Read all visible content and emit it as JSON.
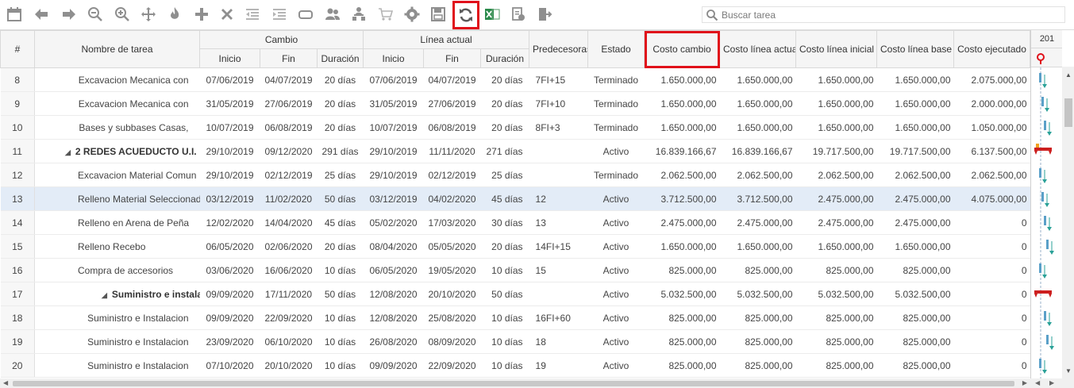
{
  "toolbar": {
    "search_placeholder": "Buscar tarea"
  },
  "columns": {
    "num": "#",
    "nombre": "Nombre de tarea",
    "cambio_group": "Cambio",
    "linea_group": "Línea actual",
    "inicio": "Inicio",
    "fin": "Fin",
    "duracion": "Duración",
    "predecesoras": "Predecesoras",
    "estado": "Estado",
    "costo_cambio": "Costo cambio",
    "costo_linea_actual": "Costo línea actual",
    "costo_linea_inicial": "Costo línea inicial",
    "costo_linea_base": "Costo línea base",
    "costo_ejecutado": "Costo ejecutado",
    "gantt_year": "201"
  },
  "rows": [
    {
      "n": "8",
      "name": "Excavacion Mecanica con",
      "ci": "07/06/2019",
      "cf": "04/07/2019",
      "cd": "20 días",
      "li": "07/06/2019",
      "lf": "04/07/2019",
      "ld": "20 días",
      "pred": "7FI+15",
      "estado": "Terminado",
      "cc": "1.650.000,00",
      "cla": "1.650.000,00",
      "cli": "1.650.000,00",
      "clb": "1.650.000,00",
      "ce": "2.075.000,00"
    },
    {
      "n": "9",
      "name": "Excavacion Mecanica con",
      "ci": "31/05/2019",
      "cf": "27/06/2019",
      "cd": "20 días",
      "li": "31/05/2019",
      "lf": "27/06/2019",
      "ld": "20 días",
      "pred": "7FI+10",
      "estado": "Terminado",
      "cc": "1.650.000,00",
      "cla": "1.650.000,00",
      "cli": "1.650.000,00",
      "clb": "1.650.000,00",
      "ce": "2.000.000,00"
    },
    {
      "n": "10",
      "name": "Bases y subbases Casas,",
      "ci": "10/07/2019",
      "cf": "06/08/2019",
      "cd": "20 días",
      "li": "10/07/2019",
      "lf": "06/08/2019",
      "ld": "20 días",
      "pred": "8FI+3",
      "estado": "Terminado",
      "cc": "1.650.000,00",
      "cla": "1.650.000,00",
      "cli": "1.650.000,00",
      "clb": "1.650.000,00",
      "ce": "1.050.000,00"
    },
    {
      "n": "11",
      "name": "2 REDES ACUEDUCTO U.I.",
      "ci": "29/10/2019",
      "cf": "09/12/2020",
      "cd": "291 días",
      "li": "29/10/2019",
      "lf": "11/11/2020",
      "ld": "271 días",
      "pred": "",
      "estado": "Activo",
      "cc": "16.839.166,67",
      "cla": "16.839.166,67",
      "cli": "19.717.500,00",
      "clb": "19.717.500,00",
      "ce": "6.137.500,00"
    },
    {
      "n": "12",
      "name": "Excavacion Material Comun",
      "ci": "29/10/2019",
      "cf": "02/12/2019",
      "cd": "25 días",
      "li": "29/10/2019",
      "lf": "02/12/2019",
      "ld": "25 días",
      "pred": "",
      "estado": "Terminado",
      "cc": "2.062.500,00",
      "cla": "2.062.500,00",
      "cli": "2.062.500,00",
      "clb": "2.062.500,00",
      "ce": "2.062.500,00"
    },
    {
      "n": "13",
      "name": "Relleno Material Seleccionad",
      "ci": "03/12/2019",
      "cf": "11/02/2020",
      "cd": "50 días",
      "li": "03/12/2019",
      "lf": "04/02/2020",
      "ld": "45 días",
      "pred": "12",
      "estado": "Activo",
      "cc": "3.712.500,00",
      "cla": "3.712.500,00",
      "cli": "2.475.000,00",
      "clb": "2.475.000,00",
      "ce": "4.075.000,00"
    },
    {
      "n": "14",
      "name": "Relleno en Arena de Peña",
      "ci": "12/02/2020",
      "cf": "14/04/2020",
      "cd": "45 días",
      "li": "05/02/2020",
      "lf": "17/03/2020",
      "ld": "30 días",
      "pred": "13",
      "estado": "Activo",
      "cc": "2.475.000,00",
      "cla": "2.475.000,00",
      "cli": "2.475.000,00",
      "clb": "2.475.000,00",
      "ce": "0"
    },
    {
      "n": "15",
      "name": "Relleno Recebo",
      "ci": "06/05/2020",
      "cf": "02/06/2020",
      "cd": "20 días",
      "li": "08/04/2020",
      "lf": "05/05/2020",
      "ld": "20 días",
      "pred": "14FI+15",
      "estado": "Activo",
      "cc": "1.650.000,00",
      "cla": "1.650.000,00",
      "cli": "1.650.000,00",
      "clb": "1.650.000,00",
      "ce": "0"
    },
    {
      "n": "16",
      "name": "Compra de accesorios",
      "ci": "03/06/2020",
      "cf": "16/06/2020",
      "cd": "10 días",
      "li": "06/05/2020",
      "lf": "19/05/2020",
      "ld": "10 días",
      "pred": "15",
      "estado": "Activo",
      "cc": "825.000,00",
      "cla": "825.000,00",
      "cli": "825.000,00",
      "clb": "825.000,00",
      "ce": "0"
    },
    {
      "n": "17",
      "name": "Suministro e instalación",
      "ci": "09/09/2020",
      "cf": "17/11/2020",
      "cd": "50 días",
      "li": "12/08/2020",
      "lf": "20/10/2020",
      "ld": "50 días",
      "pred": "",
      "estado": "Activo",
      "cc": "5.032.500,00",
      "cla": "5.032.500,00",
      "cli": "5.032.500,00",
      "clb": "5.032.500,00",
      "ce": "0"
    },
    {
      "n": "18",
      "name": "Suministro e Instalacion",
      "ci": "09/09/2020",
      "cf": "22/09/2020",
      "cd": "10 días",
      "li": "12/08/2020",
      "lf": "25/08/2020",
      "ld": "10 días",
      "pred": "16FI+60",
      "estado": "Activo",
      "cc": "825.000,00",
      "cla": "825.000,00",
      "cli": "825.000,00",
      "clb": "825.000,00",
      "ce": "0"
    },
    {
      "n": "19",
      "name": "Suministro e Instalacion",
      "ci": "23/09/2020",
      "cf": "06/10/2020",
      "cd": "10 días",
      "li": "26/08/2020",
      "lf": "08/09/2020",
      "ld": "10 días",
      "pred": "18",
      "estado": "Activo",
      "cc": "825.000,00",
      "cla": "825.000,00",
      "cli": "825.000,00",
      "clb": "825.000,00",
      "ce": "0"
    },
    {
      "n": "20",
      "name": "Suministro e Instalacion",
      "ci": "07/10/2020",
      "cf": "20/10/2020",
      "cd": "10 días",
      "li": "09/09/2020",
      "lf": "22/09/2020",
      "ld": "10 días",
      "pred": "19",
      "estado": "Activo",
      "cc": "825.000,00",
      "cla": "825.000,00",
      "cli": "825.000,00",
      "clb": "825.000,00",
      "ce": "0"
    }
  ],
  "colors": {
    "highlight": "#e0101a",
    "selected_row": "#e3ecf7",
    "gantt_bar": "#2aa198",
    "gantt_group": "#cc1f1f",
    "gantt_progress": "#f0a020"
  }
}
